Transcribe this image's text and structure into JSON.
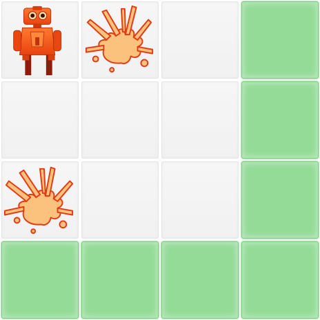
{
  "game": {
    "grid_size": 4,
    "colors": {
      "empty": "#f3f3f3",
      "goal": "#93db97",
      "robot": "#f0541a",
      "explosion": "#fbc27e"
    },
    "cells": [
      [
        "robot",
        "explosion",
        "empty",
        "goal"
      ],
      [
        "empty",
        "empty",
        "empty",
        "goal"
      ],
      [
        "explosion",
        "empty",
        "empty",
        "goal"
      ],
      [
        "goal",
        "goal",
        "goal",
        "goal"
      ]
    ],
    "icons": {
      "robot": "robot-icon",
      "explosion": "explosion-icon"
    }
  }
}
